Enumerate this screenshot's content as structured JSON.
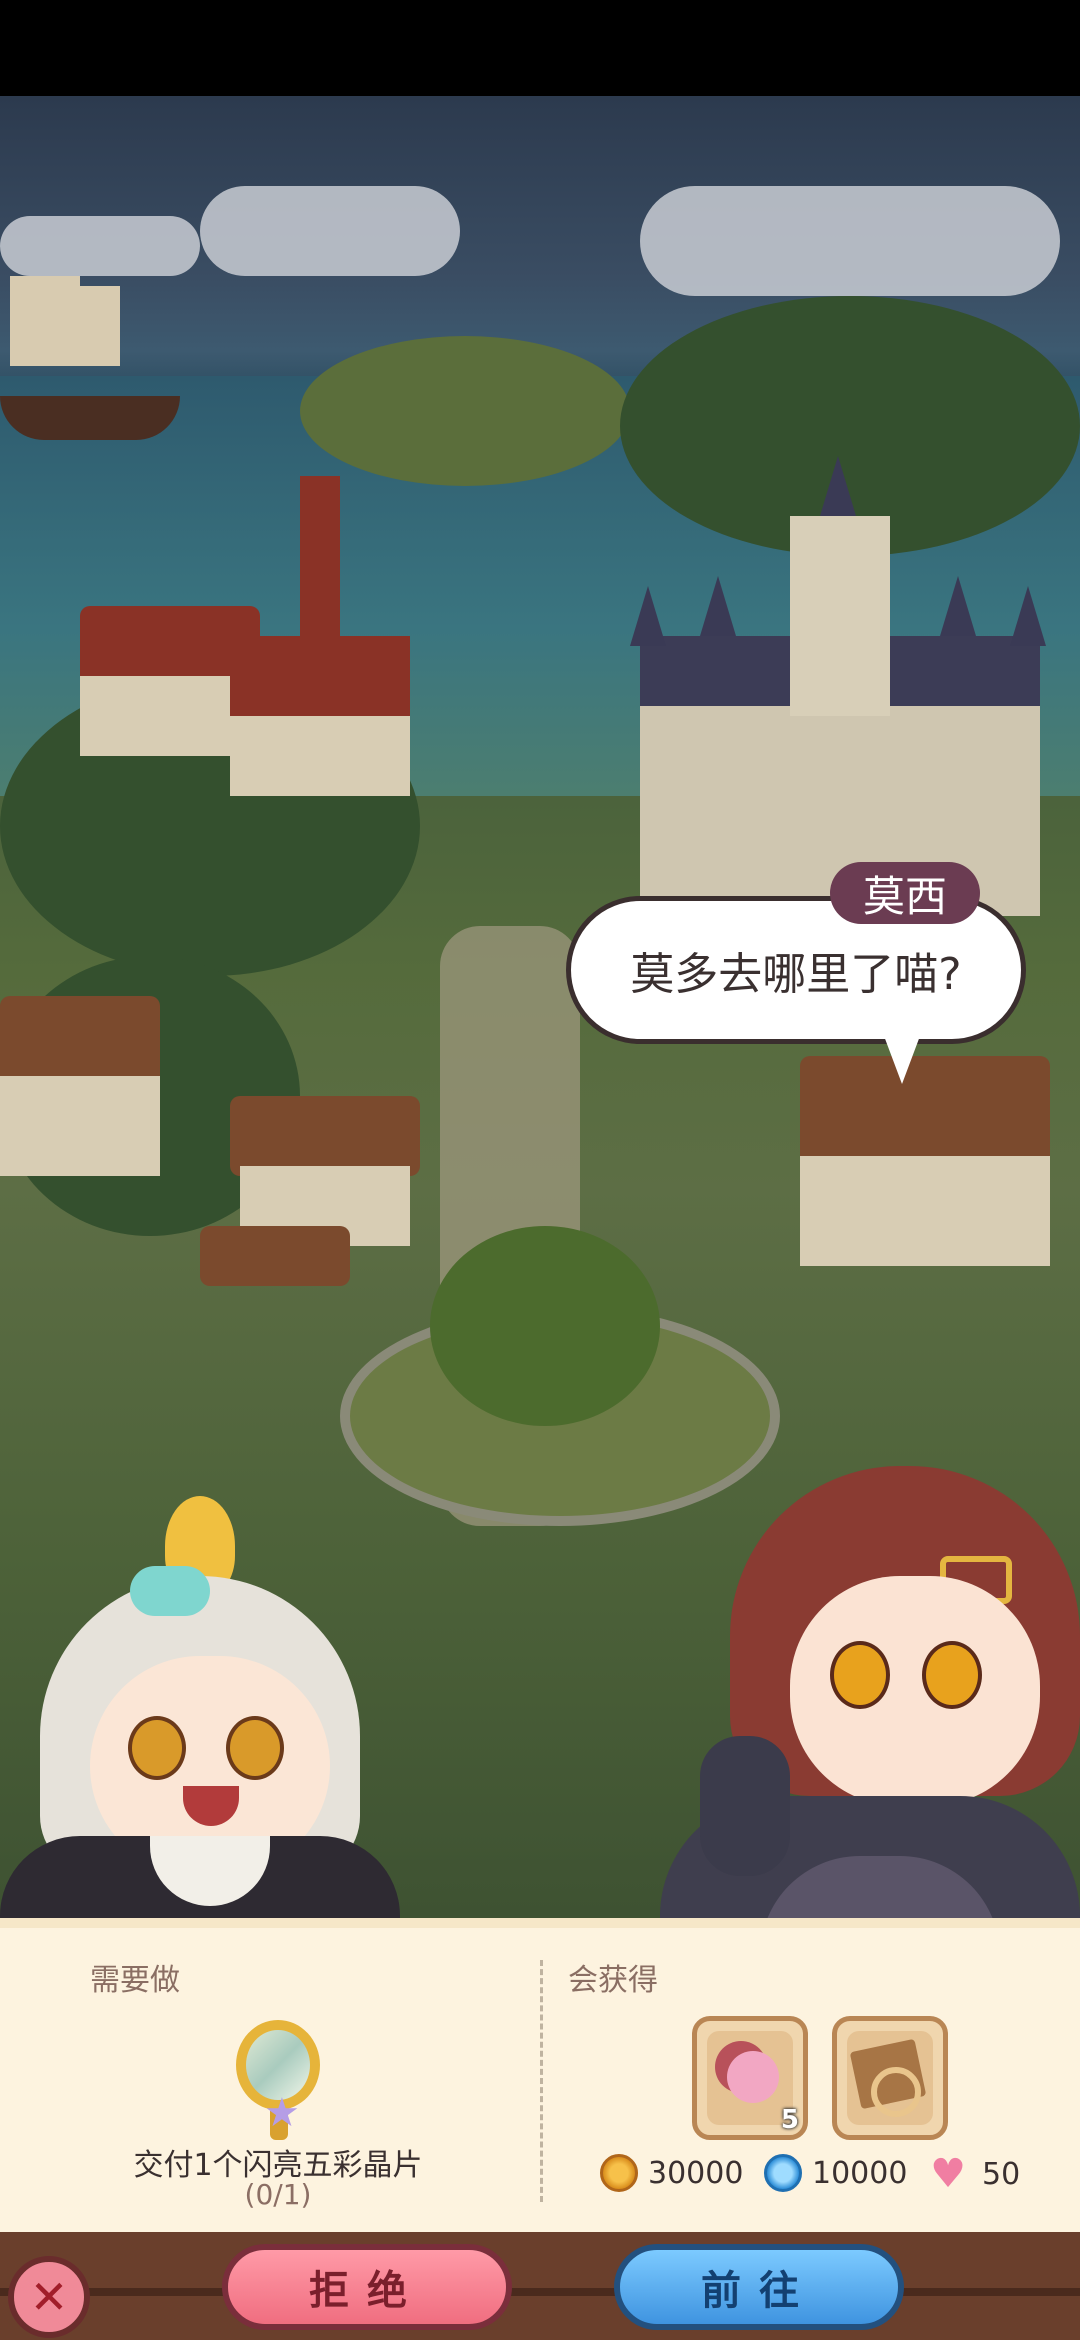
{
  "dialogue": {
    "speaker": "莫西",
    "text": "莫多去哪里了喵?"
  },
  "quest": {
    "todo_label": "需要做",
    "reward_label": "会获得",
    "task_text": "交付1个闪亮五彩晶片",
    "task_progress": "(0/1)",
    "task_item_icon": "rainbow-mirror-icon",
    "rewards": [
      {
        "icon": "macaron-icon",
        "count": "5"
      },
      {
        "icon": "treasure-map-icon",
        "count": ""
      }
    ],
    "currencies": [
      {
        "icon": "gold-coin-icon",
        "value": "30000",
        "color": "#e8a628"
      },
      {
        "icon": "blue-gem-icon",
        "value": "10000",
        "color": "#2f8fd8"
      },
      {
        "icon": "heart-icon",
        "value": "50",
        "color": "#f07ea2"
      }
    ]
  },
  "buttons": {
    "close": "✕",
    "reject": "拒绝",
    "go": "前往"
  }
}
